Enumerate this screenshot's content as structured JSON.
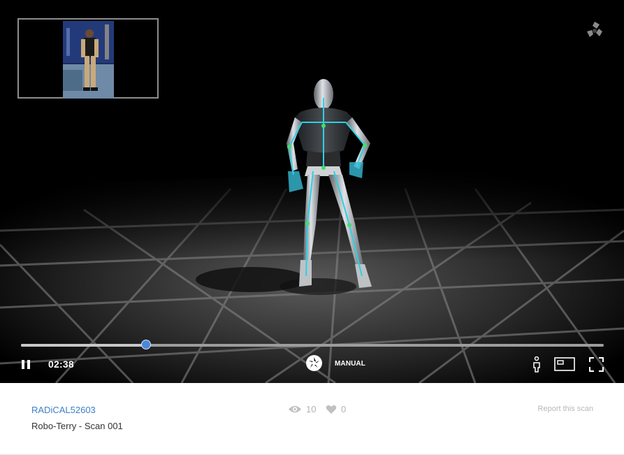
{
  "viewer": {
    "playback": {
      "time": "02:38",
      "progress": 0.215,
      "state": "playing"
    },
    "camera_mode": "MANUAL",
    "icons": {
      "brand": "radical-logo-icon",
      "play_pause": "pause-icon",
      "camera": "camera-aperture-icon",
      "skeleton": "skeleton-figure-icon",
      "pip": "picture-in-picture-icon",
      "fullscreen": "fullscreen-icon"
    },
    "colors": {
      "accent": "#4a88d8",
      "background": "#000000"
    }
  },
  "info": {
    "username": "RADiCAL52603",
    "title": "Robo-Terry - Scan 001",
    "views": "10",
    "likes": "0",
    "report_label": "Report this scan",
    "icons": {
      "views": "eye-icon",
      "likes": "heart-icon"
    }
  }
}
